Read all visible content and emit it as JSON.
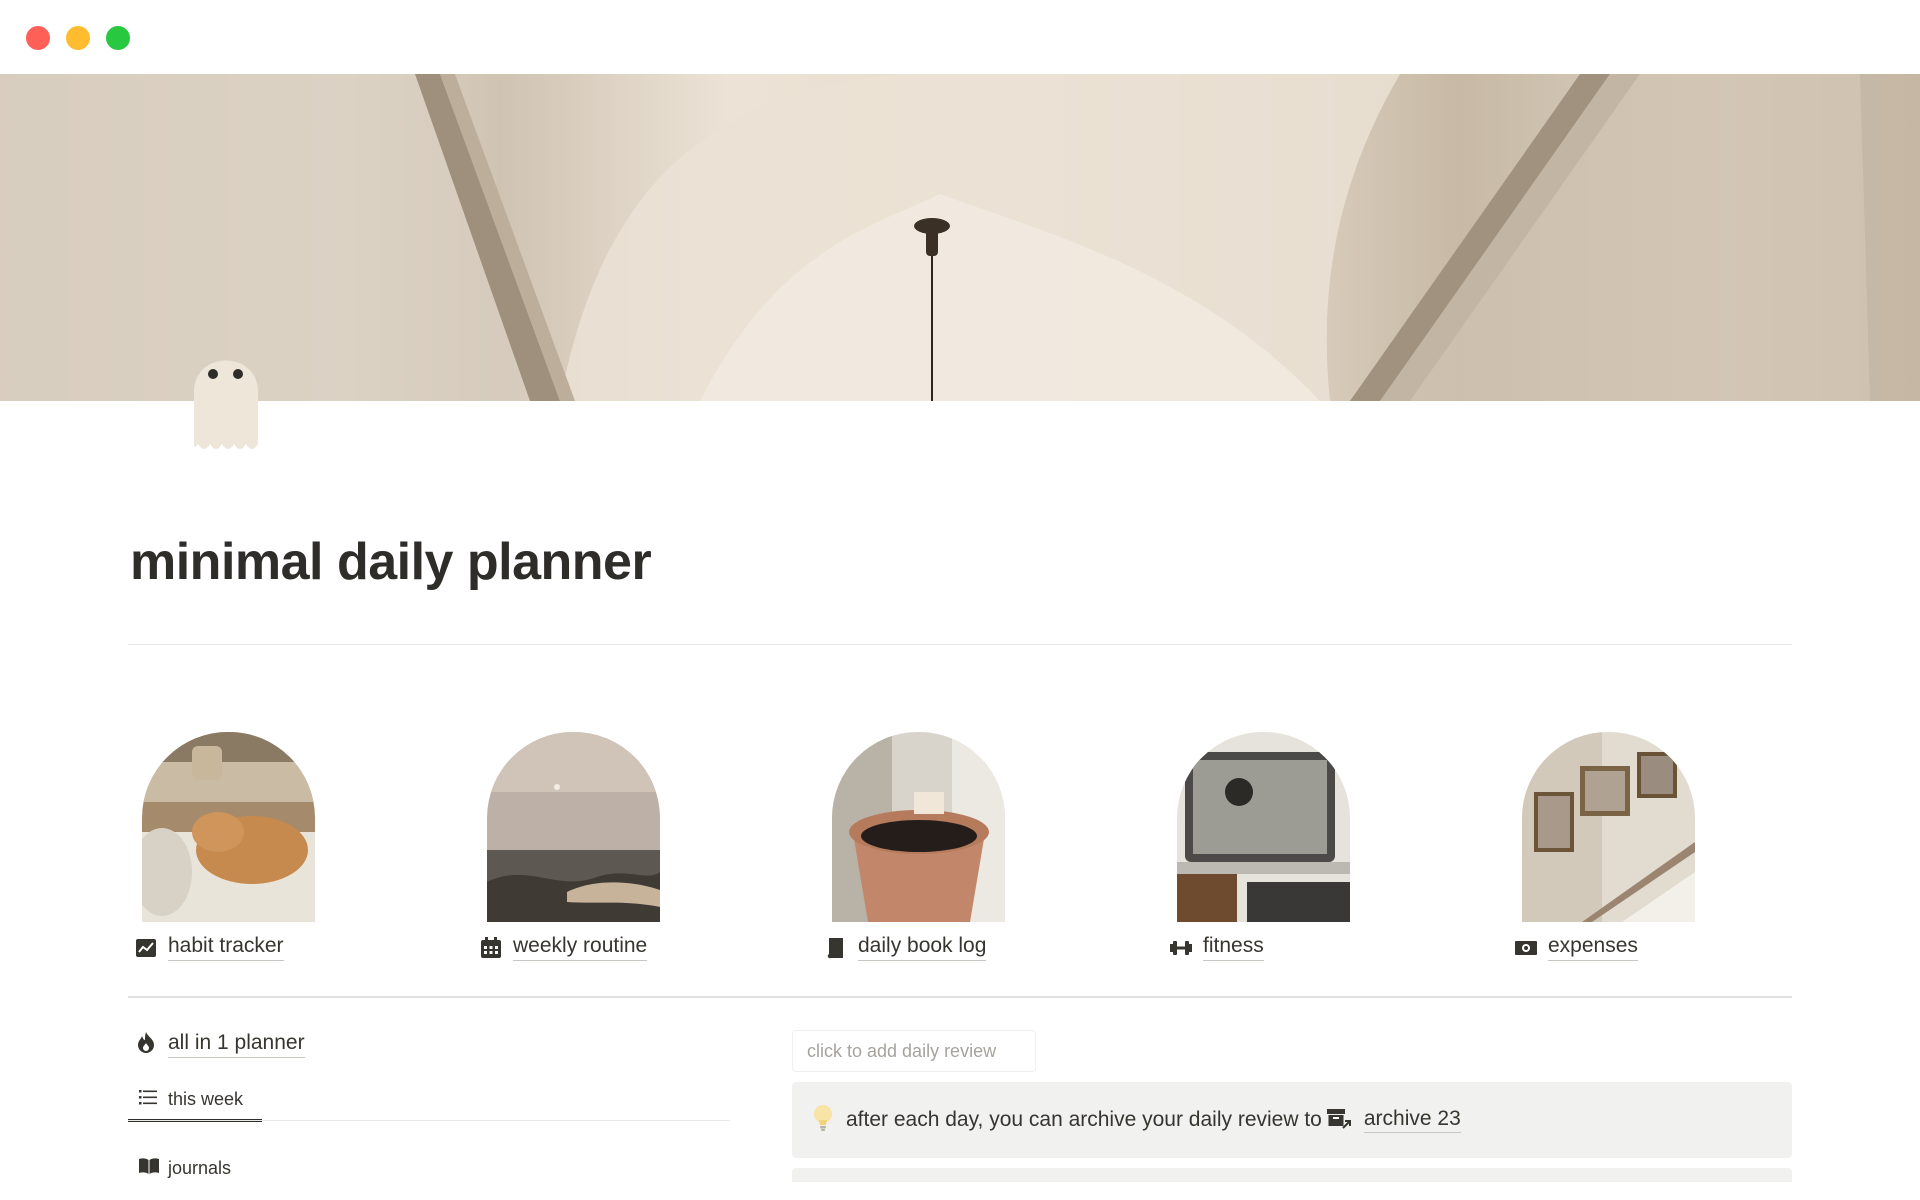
{
  "window": {
    "controls": [
      "close",
      "minimize",
      "maximize"
    ],
    "colors": {
      "close": "#fe5f57",
      "minimize": "#febc2e",
      "maximize": "#28c840"
    }
  },
  "page": {
    "icon": "ghost-icon",
    "title": "minimal daily planner"
  },
  "gallery": [
    {
      "label": "habit tracker",
      "icon": "chart-icon",
      "image": "sleeping-cat-photo"
    },
    {
      "label": "weekly routine",
      "icon": "calendar-icon",
      "image": "sea-sunset-photo"
    },
    {
      "label": "daily book log",
      "icon": "book-icon",
      "image": "plant-pot-photo"
    },
    {
      "label": "fitness",
      "icon": "dumbbell-icon",
      "image": "laptop-drink-photo"
    },
    {
      "label": "expenses",
      "icon": "money-icon",
      "image": "stairs-frames-photo"
    }
  ],
  "planner": {
    "link_label": "all in 1 planner",
    "link_icon": "flame-icon",
    "tab_label": "this week",
    "tab_icon": "list-icon",
    "journals_label": "journals",
    "journals_icon": "open-book-icon"
  },
  "review": {
    "add_button": "click to add daily review",
    "callout_text": "after each day, you can archive your daily review to",
    "callout_icon": "lightbulb-icon",
    "archive_icon": "archive-icon",
    "archive_link": "archive 23"
  }
}
